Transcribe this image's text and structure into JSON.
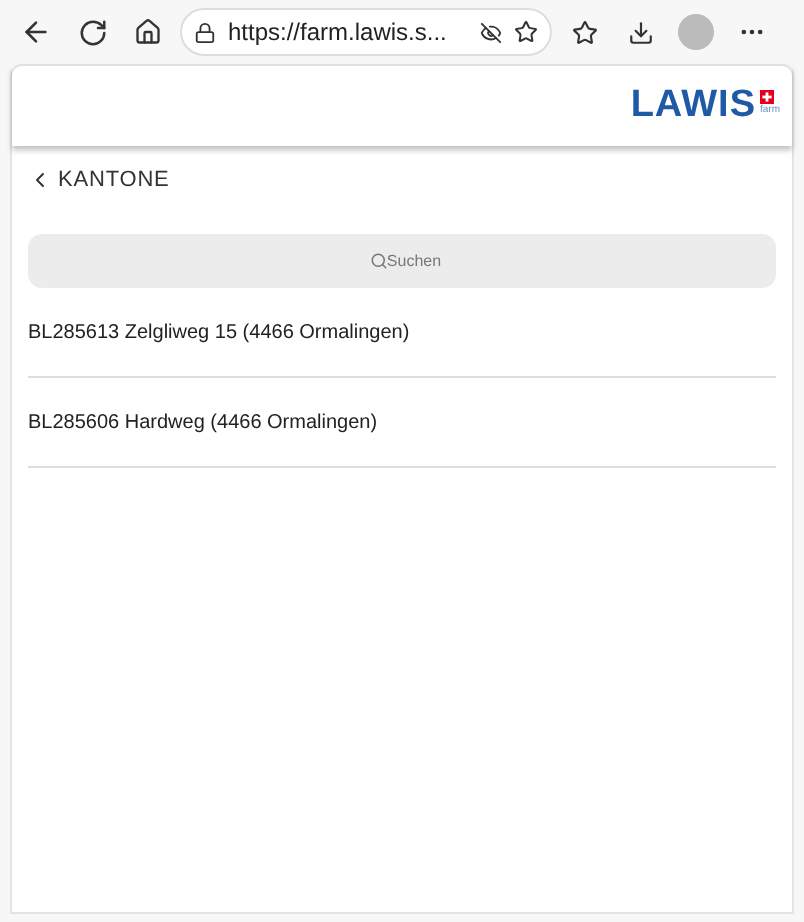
{
  "browser": {
    "url": "https://farm.lawis.s..."
  },
  "header": {
    "logo": "LAWIS",
    "logo_sub": "farm"
  },
  "back_link": {
    "label": "KANTONE"
  },
  "search": {
    "placeholder": "Suchen"
  },
  "farms": [
    {
      "label": "BL285613 Zelgliweg 15 (4466 Ormalingen)"
    },
    {
      "label": "BL285606 Hardweg (4466 Ormalingen)"
    }
  ]
}
